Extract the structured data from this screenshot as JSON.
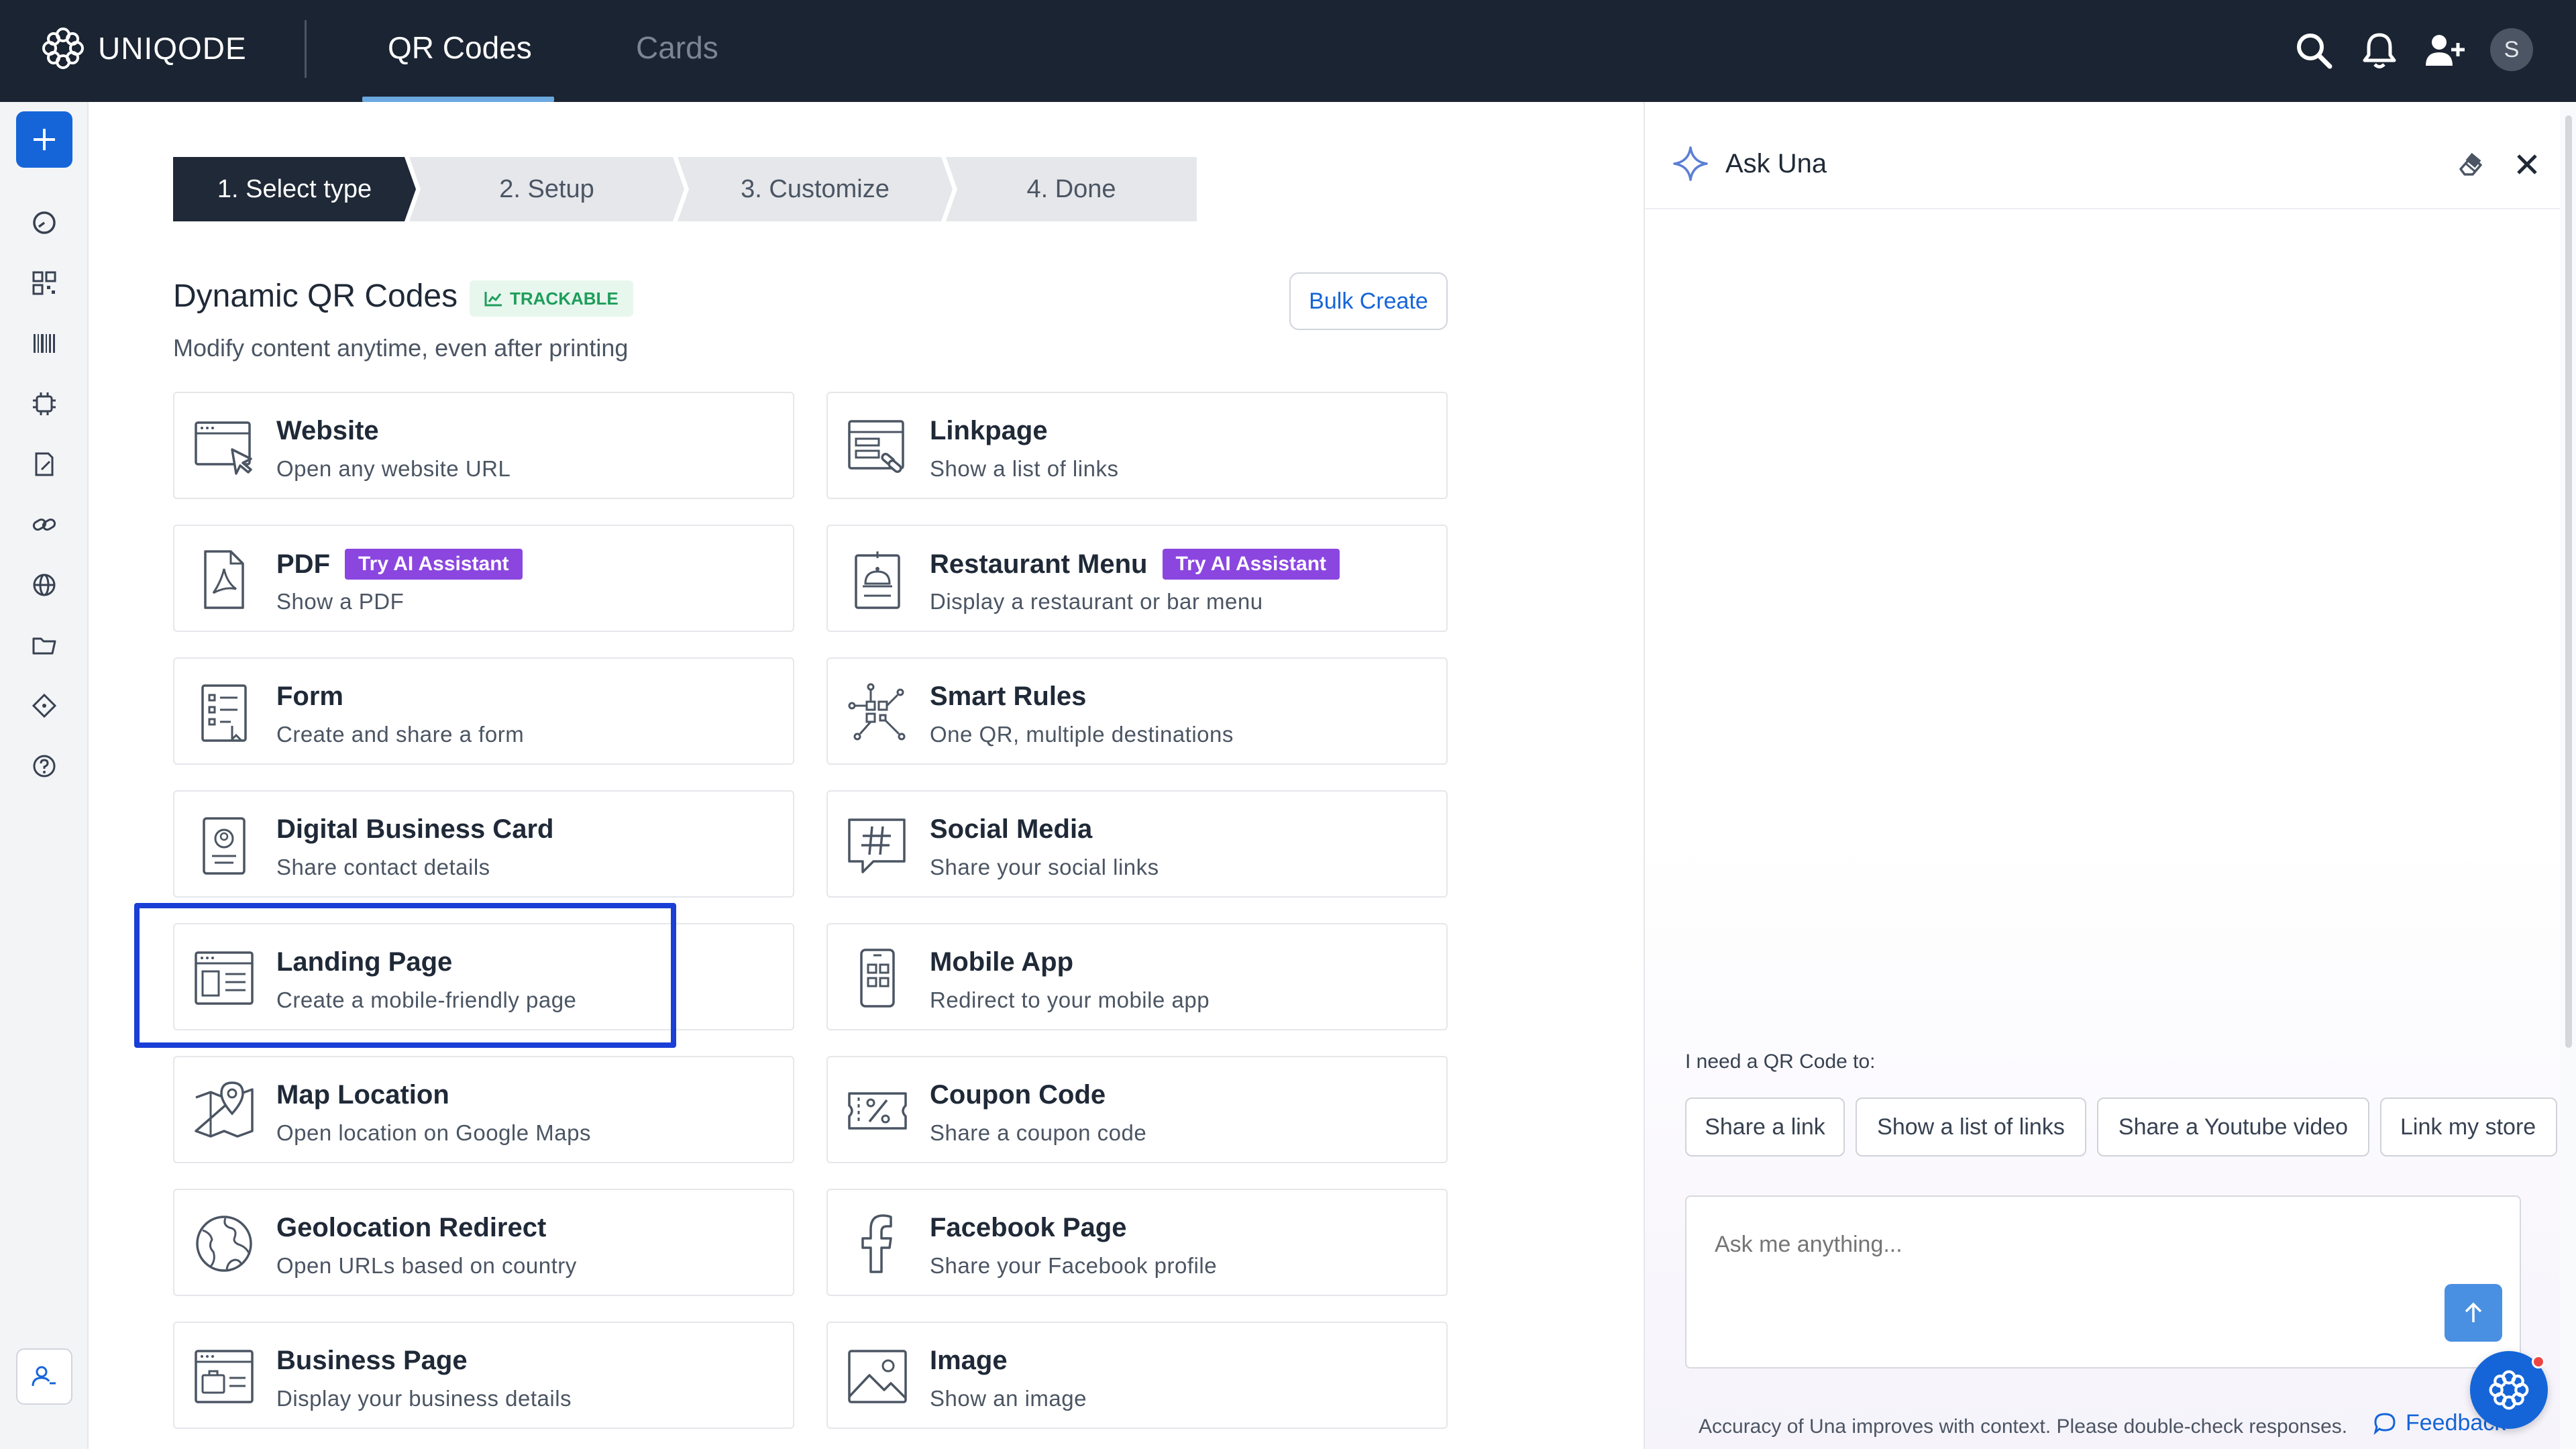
{
  "app": {
    "brand": "UNIQODE",
    "tabs": [
      {
        "label": "QR Codes",
        "active": true
      },
      {
        "label": "Cards",
        "active": false
      }
    ],
    "avatar_initial": "S",
    "icons": [
      "search-icon",
      "bell-icon",
      "add-user-icon"
    ]
  },
  "sidebar": {
    "items": [
      "plus-icon",
      "dashboard-icon",
      "qr-grid-icon",
      "barcode-icon",
      "ai-chip-icon",
      "edit-doc-icon",
      "link-icon",
      "globe-icon",
      "folder-icon",
      "tag-icon",
      "help-icon",
      "user-settings-icon"
    ]
  },
  "stepper": {
    "steps": [
      "1. Select type",
      "2. Setup",
      "3. Customize",
      "4. Done"
    ],
    "active_index": 0
  },
  "section": {
    "title": "Dynamic QR Codes",
    "badge": "TRACKABLE",
    "subtitle": "Modify content anytime, even after printing",
    "bulk_button": "Bulk Create"
  },
  "cards": [
    {
      "title": "Website",
      "desc": "Open any website URL",
      "icon": "website-cursor-icon"
    },
    {
      "title": "Linkpage",
      "desc": "Show a list of links",
      "icon": "linkpage-icon"
    },
    {
      "title": "PDF",
      "desc": "Show a PDF",
      "badge": "Try AI Assistant",
      "icon": "pdf-icon"
    },
    {
      "title": "Restaurant Menu",
      "desc": "Display a restaurant or bar menu",
      "badge": "Try AI Assistant",
      "icon": "restaurant-menu-icon"
    },
    {
      "title": "Form",
      "desc": "Create and share a form",
      "icon": "form-icon"
    },
    {
      "title": "Smart Rules",
      "desc": "One QR, multiple destinations",
      "icon": "smart-rules-icon"
    },
    {
      "title": "Digital Business Card",
      "desc": "Share contact details",
      "icon": "business-card-icon"
    },
    {
      "title": "Social Media",
      "desc": "Share your social links",
      "icon": "hashtag-icon"
    },
    {
      "title": "Landing Page",
      "desc": "Create a mobile-friendly page",
      "icon": "landing-page-icon",
      "selected": true
    },
    {
      "title": "Mobile App",
      "desc": "Redirect to your mobile app",
      "icon": "mobile-app-icon"
    },
    {
      "title": "Map Location",
      "desc": "Open location on Google Maps",
      "icon": "map-pin-icon"
    },
    {
      "title": "Coupon Code",
      "desc": "Share a coupon code",
      "icon": "coupon-icon"
    },
    {
      "title": "Geolocation Redirect",
      "desc": "Open URLs based on country",
      "icon": "geolocation-globe-icon"
    },
    {
      "title": "Facebook Page",
      "desc": "Share your Facebook profile",
      "icon": "facebook-icon"
    },
    {
      "title": "Business Page",
      "desc": "Display your business details",
      "icon": "business-page-icon"
    },
    {
      "title": "Image",
      "desc": "Show an image",
      "icon": "image-icon"
    }
  ],
  "assistant": {
    "title": "Ask Una",
    "prompt_label": "I need a QR Code to:",
    "chips": [
      "Share a link",
      "Show a list of links",
      "Share a Youtube video",
      "Link my store"
    ],
    "input_placeholder": "Ask me anything...",
    "disclaimer": "Accuracy of Una improves with context. Please double-check responses.",
    "feedback": "Feedback"
  },
  "colors": {
    "topbar": "#1b2432",
    "accent": "#1565d8",
    "ai_badge": "#8b46e0",
    "trackable_bg": "#e7f7ee",
    "trackable_text": "#1e9e5a",
    "selection_outline": "#1a3fd6"
  }
}
